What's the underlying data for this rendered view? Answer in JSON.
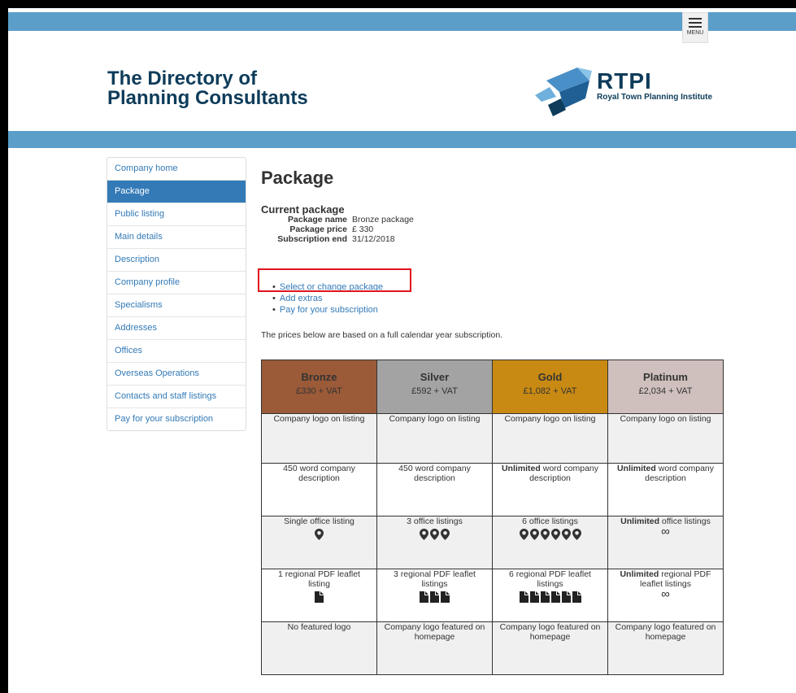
{
  "header": {
    "menu_label": "MENU",
    "title_line1": "The Directory of",
    "title_line2": "Planning Consultants",
    "logo_name": "RTPI",
    "logo_sub": "Royal Town Planning Institute",
    "bar_color": "#5b9ec9"
  },
  "sidebar": {
    "items": [
      {
        "label": "Company home"
      },
      {
        "label": "Package"
      },
      {
        "label": "Public listing"
      },
      {
        "label": "Main details"
      },
      {
        "label": "Description"
      },
      {
        "label": "Company profile"
      },
      {
        "label": "Specialisms"
      },
      {
        "label": "Addresses"
      },
      {
        "label": "Offices"
      },
      {
        "label": "Overseas Operations"
      },
      {
        "label": "Contacts and staff listings"
      },
      {
        "label": "Pay for your subscription"
      }
    ],
    "active_index": 1
  },
  "main": {
    "heading": "Package",
    "current_title": "Current package",
    "info": [
      {
        "label": "Package name",
        "value": "Bronze package"
      },
      {
        "label": "Package price",
        "value": "£ 330"
      },
      {
        "label": "Subscription end",
        "value": "31/12/2018"
      }
    ],
    "links": [
      "Select or change package",
      "Add extras",
      "Pay for your subscription"
    ],
    "note": "The prices below are based on a full calendar year subscription."
  },
  "packages": [
    {
      "name": "Bronze",
      "price": "£330 + VAT",
      "color": "#9b5a38"
    },
    {
      "name": "Silver",
      "price": "£592 + VAT",
      "color": "#a3a3a3"
    },
    {
      "name": "Gold",
      "price": "£1,082 + VAT",
      "color": "#c98a13"
    },
    {
      "name": "Platinum",
      "price": "£2,034 + VAT",
      "color": "#cfc0bd"
    }
  ],
  "rows": [
    {
      "key": "logo",
      "cells": [
        {
          "text": "Company logo on listing"
        },
        {
          "text": "Company logo on listing"
        },
        {
          "text": "Company logo on listing"
        },
        {
          "text": "Company logo on listing"
        }
      ]
    },
    {
      "key": "description",
      "cells": [
        {
          "text": "450 word company description"
        },
        {
          "text": "450 word company description"
        },
        {
          "bold": "Unlimited",
          "text": " word company description"
        },
        {
          "bold": "Unlimited",
          "text": " word company description"
        }
      ]
    },
    {
      "key": "offices",
      "cells": [
        {
          "text": "Single office listing",
          "count": 1,
          "icon": "map-pin-icon"
        },
        {
          "text": "3 office listings",
          "count": 3,
          "icon": "map-pin-icon"
        },
        {
          "text": "6 office listings",
          "count": 6,
          "icon": "map-pin-icon"
        },
        {
          "bold": "Unlimited",
          "text": " office listings",
          "infinite": true
        }
      ]
    },
    {
      "key": "leaflets",
      "cells": [
        {
          "text": "1 regional PDF leaflet listing",
          "count": 1,
          "icon": "document-icon"
        },
        {
          "text": "3 regional PDF leaflet listings",
          "count": 3,
          "icon": "document-icon"
        },
        {
          "text": "6 regional PDF leaflet listings",
          "count": 6,
          "icon": "document-icon"
        },
        {
          "bold": "Unlimited",
          "text": " regional PDF leaflet listings",
          "infinite": true
        }
      ]
    },
    {
      "key": "featured",
      "cells": [
        {
          "text": "No featured logo"
        },
        {
          "text": "Company logo featured on homepage"
        },
        {
          "text": "Company logo featured on homepage"
        },
        {
          "text": "Company logo featured on homepage"
        }
      ]
    }
  ],
  "infinity_symbol": "∞"
}
